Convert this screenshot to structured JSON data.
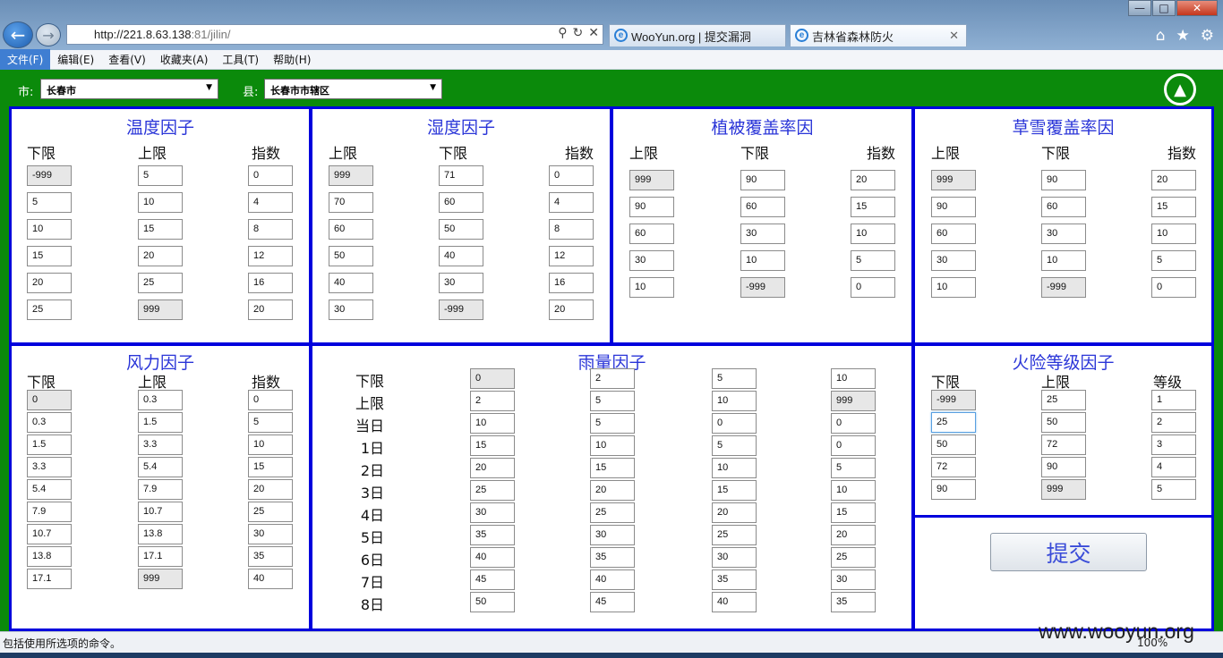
{
  "browser": {
    "url_host": "http://221.8.63.138",
    "url_port": ":81/jilin/",
    "tabs": [
      {
        "label": "WooYun.org | 提交漏洞"
      },
      {
        "label": "吉林省森林防火"
      }
    ],
    "menu": [
      "文件(F)",
      "编辑(E)",
      "查看(V)",
      "收藏夹(A)",
      "工具(T)",
      "帮助(H)"
    ],
    "status_text": "包括使用所选项的命令。",
    "zoom": "100%",
    "watermark": "www.wooyun.org"
  },
  "filters": {
    "city_label": "市:",
    "city_value": "长春市",
    "county_label": "县:",
    "county_value": "长春市市辖区"
  },
  "panels": {
    "temperature": {
      "title": "温度因子",
      "headers": [
        "下限",
        "上限",
        "指数"
      ],
      "rows": [
        [
          "-999",
          "5",
          "0"
        ],
        [
          "5",
          "10",
          "4"
        ],
        [
          "10",
          "15",
          "8"
        ],
        [
          "15",
          "20",
          "12"
        ],
        [
          "20",
          "25",
          "16"
        ],
        [
          "25",
          "999",
          "20"
        ]
      ]
    },
    "humidity": {
      "title": "湿度因子",
      "headers": [
        "上限",
        "下限",
        "指数"
      ],
      "rows": [
        [
          "999",
          "71",
          "0"
        ],
        [
          "70",
          "60",
          "4"
        ],
        [
          "60",
          "50",
          "8"
        ],
        [
          "50",
          "40",
          "12"
        ],
        [
          "40",
          "30",
          "16"
        ],
        [
          "30",
          "-999",
          "20"
        ]
      ]
    },
    "vegetation": {
      "title": "植被覆盖率因",
      "headers": [
        "上限",
        "下限",
        "指数"
      ],
      "rows": [
        [
          "999",
          "90",
          "20"
        ],
        [
          "90",
          "60",
          "15"
        ],
        [
          "60",
          "30",
          "10"
        ],
        [
          "30",
          "10",
          "5"
        ],
        [
          "10",
          "-999",
          "0"
        ]
      ]
    },
    "snow": {
      "title": "草雪覆盖率因",
      "headers": [
        "上限",
        "下限",
        "指数"
      ],
      "rows": [
        [
          "999",
          "90",
          "20"
        ],
        [
          "90",
          "60",
          "15"
        ],
        [
          "60",
          "30",
          "10"
        ],
        [
          "30",
          "10",
          "5"
        ],
        [
          "10",
          "-999",
          "0"
        ]
      ]
    },
    "wind": {
      "title": "风力因子",
      "headers": [
        "下限",
        "上限",
        "指数"
      ],
      "rows": [
        [
          "0",
          "0.3",
          "0"
        ],
        [
          "0.3",
          "1.5",
          "5"
        ],
        [
          "1.5",
          "3.3",
          "10"
        ],
        [
          "3.3",
          "5.4",
          "15"
        ],
        [
          "5.4",
          "7.9",
          "20"
        ],
        [
          "7.9",
          "10.7",
          "25"
        ],
        [
          "10.7",
          "13.8",
          "30"
        ],
        [
          "13.8",
          "17.1",
          "35"
        ],
        [
          "17.1",
          "999",
          "40"
        ]
      ]
    },
    "rain": {
      "title": "雨量因子",
      "row_labels": [
        "下限",
        "上限",
        "当日",
        "1日",
        "2日",
        "3日",
        "4日",
        "5日",
        "6日",
        "7日",
        "8日"
      ],
      "rows": [
        [
          "0",
          "2",
          "5",
          "10"
        ],
        [
          "2",
          "5",
          "10",
          "999"
        ],
        [
          "10",
          "5",
          "0",
          "0"
        ],
        [
          "15",
          "10",
          "5",
          "0"
        ],
        [
          "20",
          "15",
          "10",
          "5"
        ],
        [
          "25",
          "20",
          "15",
          "10"
        ],
        [
          "30",
          "25",
          "20",
          "15"
        ],
        [
          "35",
          "30",
          "25",
          "20"
        ],
        [
          "40",
          "35",
          "30",
          "25"
        ],
        [
          "45",
          "40",
          "35",
          "30"
        ],
        [
          "50",
          "45",
          "40",
          "35"
        ]
      ]
    },
    "fire_level": {
      "title": "火险等级因子",
      "headers": [
        "下限",
        "上限",
        "等级"
      ],
      "rows": [
        [
          "-999",
          "25",
          "1"
        ],
        [
          "25",
          "50",
          "2"
        ],
        [
          "50",
          "72",
          "3"
        ],
        [
          "72",
          "90",
          "4"
        ],
        [
          "90",
          "999",
          "5"
        ]
      ]
    }
  },
  "submit_label": "提交"
}
